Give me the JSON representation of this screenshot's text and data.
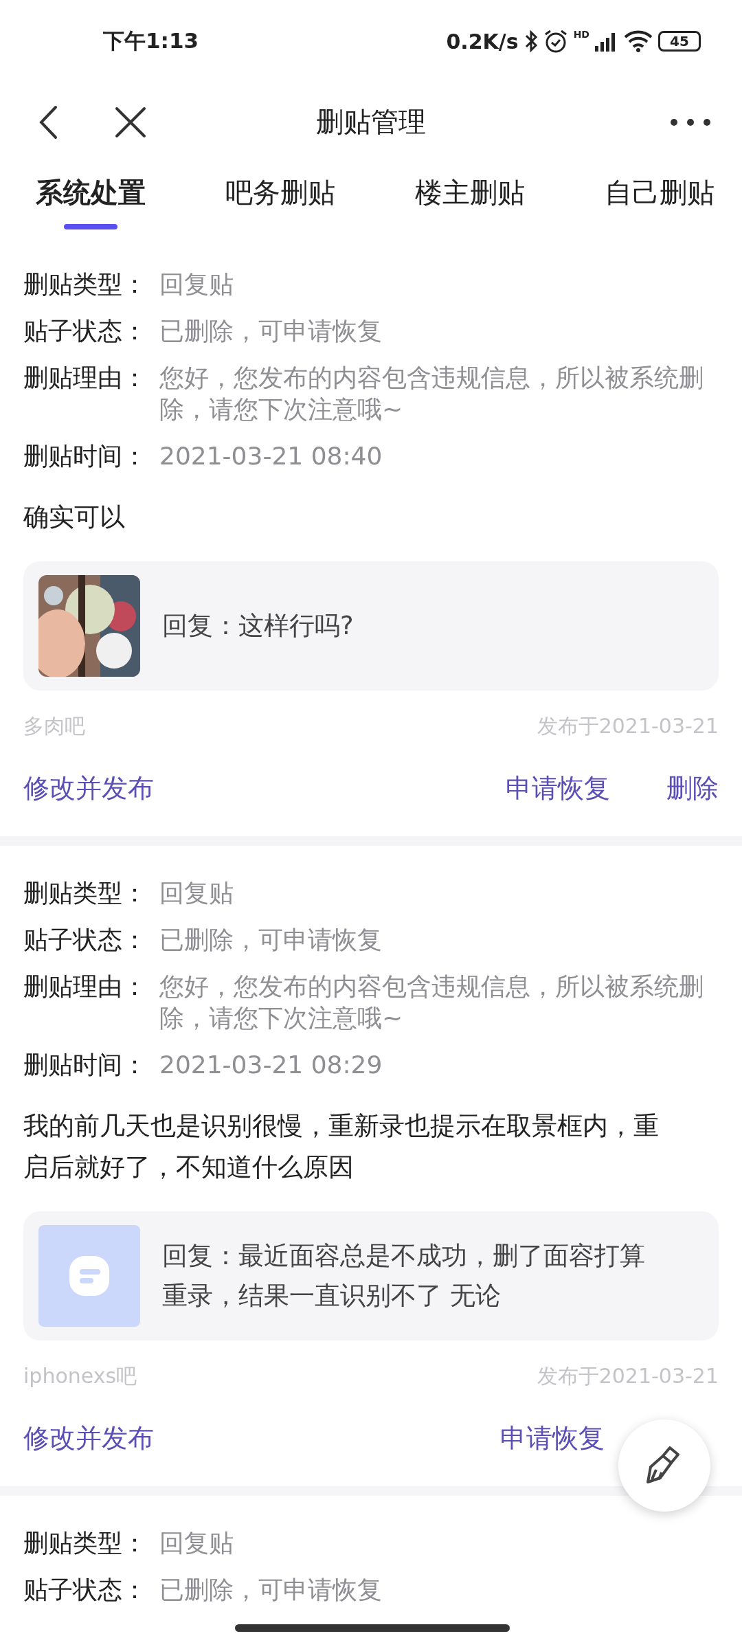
{
  "status_bar": {
    "time": "下午1:13",
    "net_speed": "0.2K/s",
    "signal_label": "HD",
    "battery": "45"
  },
  "header": {
    "title": "删贴管理"
  },
  "tabs": [
    {
      "label": "系统处置",
      "selected": true
    },
    {
      "label": "吧务删贴",
      "selected": false
    },
    {
      "label": "楼主删贴",
      "selected": false
    },
    {
      "label": "自己删贴",
      "selected": false
    }
  ],
  "posts": [
    {
      "fields": [
        {
          "label": "删贴类型：",
          "value": "回复贴"
        },
        {
          "label": "贴子状态：",
          "value": "已删除，可申请恢复"
        },
        {
          "label": "删贴理由：",
          "value": "您好，您发布的内容包含违规信息，所以被系统删除，请您下次注意哦~"
        },
        {
          "label": "删贴时间：",
          "value": "2021-03-21 08:40"
        }
      ],
      "content": "确实可以",
      "quote": {
        "kind": "picture",
        "text": "回复：这样行吗?"
      },
      "forum": "多肉吧",
      "published": "发布于2021-03-21",
      "actions": [
        {
          "label": "修改并发布"
        },
        {
          "label": "申请恢复"
        },
        {
          "label": "删除"
        }
      ]
    },
    {
      "fields": [
        {
          "label": "删贴类型：",
          "value": "回复贴"
        },
        {
          "label": "贴子状态：",
          "value": "已删除，可申请恢复"
        },
        {
          "label": "删贴理由：",
          "value": "您好，您发布的内容包含违规信息，所以被系统删除，请您下次注意哦~"
        },
        {
          "label": "删贴时间：",
          "value": "2021-03-21 08:29"
        }
      ],
      "content": "我的前几天也是识别很慢，重新录也提示在取景框内，重启后就好了，不知道什么原因",
      "quote": {
        "kind": "placeholder",
        "text": "回复：最近面容总是不成功，删了面容打算重录，结果一直识别不了 无论"
      },
      "forum": "iphonexs吧",
      "published": "发布于2021-03-21",
      "actions": [
        {
          "label": "修改并发布"
        },
        {
          "label": "申请恢复"
        }
      ]
    },
    {
      "fields": [
        {
          "label": "删贴类型：",
          "value": "回复贴"
        },
        {
          "label": "贴子状态：",
          "value": "已删除，可申请恢复"
        }
      ]
    }
  ]
}
